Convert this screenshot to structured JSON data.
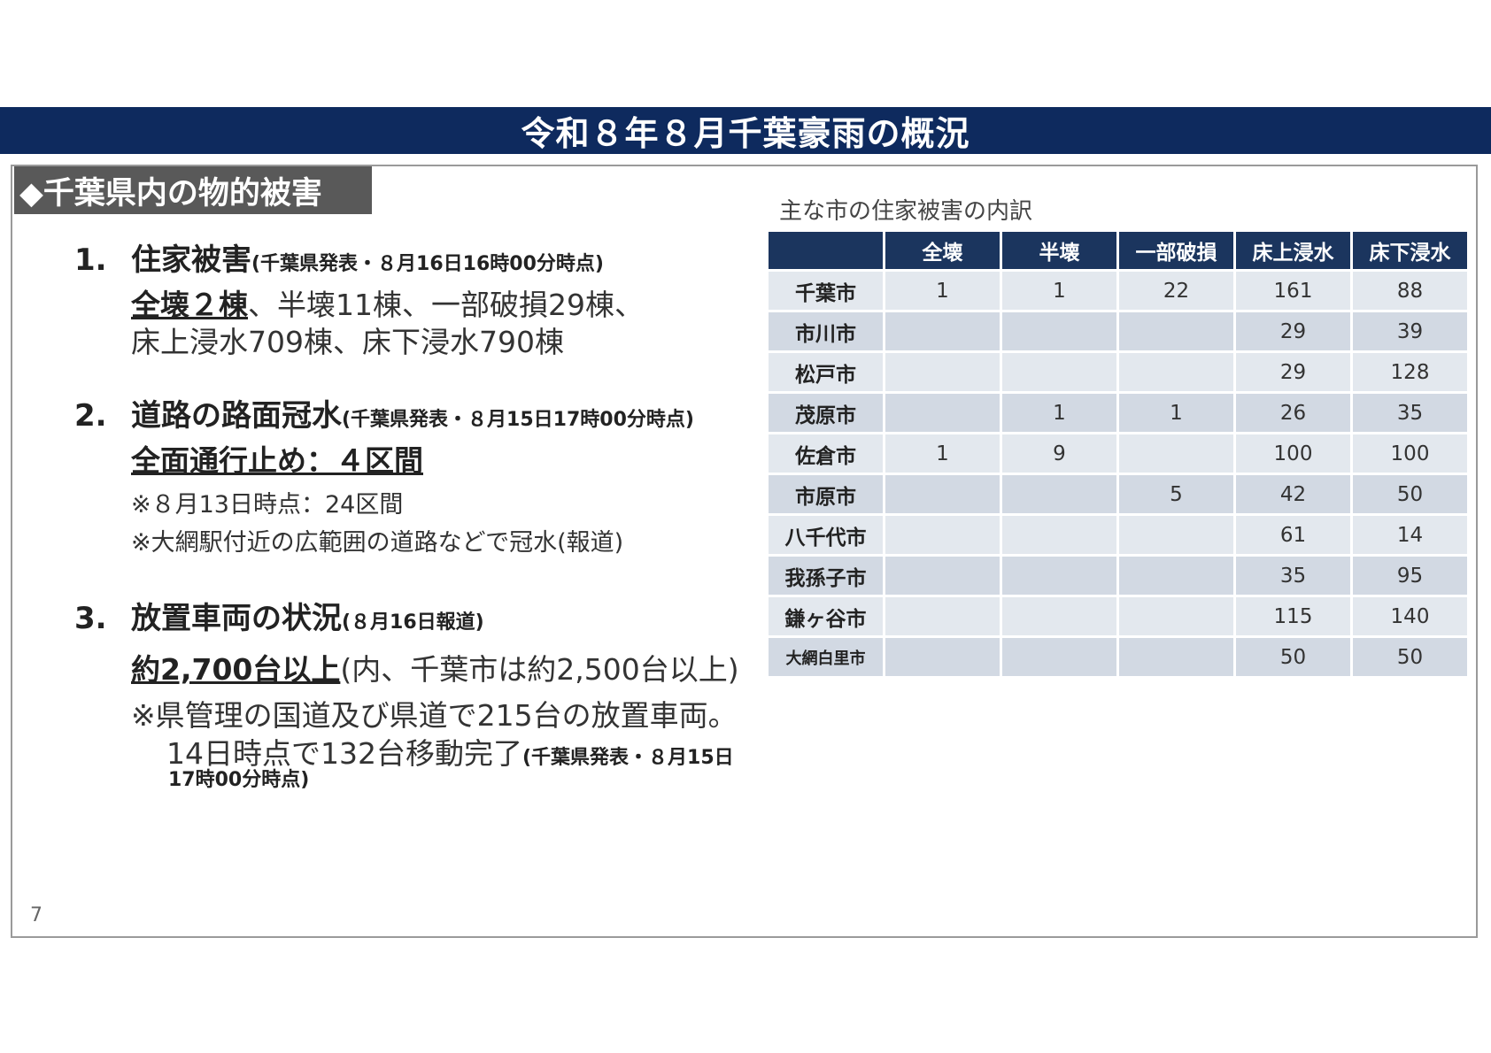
{
  "title": "令和８年８月千葉豪雨の概況",
  "section": "◆千葉県内の物的被害",
  "items": [
    {
      "num": "1.",
      "heading": "住家被害",
      "source": "(千葉県発表・８月16日16時00分時点)",
      "line1_underlined": "全壊２棟",
      "line1_rest": "、半壊11棟、一部破損29棟、",
      "line2": "床上浸水709棟、床下浸水790棟"
    },
    {
      "num": "2.",
      "heading": "道路の路面冠水",
      "source": "(千葉県発表・８月15日17時00分時点)",
      "line1": "全面通行止め：４区間",
      "note1": "※８月13日時点：24区間",
      "note2": "※大網駅付近の広範囲の道路などで冠水(報道)"
    },
    {
      "num": "3.",
      "heading": "放置車両の状況",
      "source": "(８月16日報道)",
      "line1_underlined": "約2,700台以上",
      "line1_rest": "(内、千葉市は約2,500台以上)",
      "line2": "※県管理の国道及び県道で215台の放置車両。",
      "line3": "14日時点で132台移動完了",
      "line3_source": "(千葉県発表・８月15日",
      "line4_source": "17時00分時点)"
    }
  ],
  "table": {
    "caption": "主な市の住家被害の内訳",
    "headers": [
      "",
      "全壊",
      "半壊",
      "一部破損",
      "床上浸水",
      "床下浸水"
    ],
    "rows": [
      [
        "千葉市",
        "1",
        "1",
        "22",
        "161",
        "88"
      ],
      [
        "市川市",
        "",
        "",
        "",
        "29",
        "39"
      ],
      [
        "松戸市",
        "",
        "",
        "",
        "29",
        "128"
      ],
      [
        "茂原市",
        "",
        "1",
        "1",
        "26",
        "35"
      ],
      [
        "佐倉市",
        "1",
        "9",
        "",
        "100",
        "100"
      ],
      [
        "市原市",
        "",
        "",
        "5",
        "42",
        "50"
      ],
      [
        "八千代市",
        "",
        "",
        "",
        "61",
        "14"
      ],
      [
        "我孫子市",
        "",
        "",
        "",
        "35",
        "95"
      ],
      [
        "鎌ヶ谷市",
        "",
        "",
        "",
        "115",
        "140"
      ],
      [
        "大網白里市",
        "",
        "",
        "",
        "50",
        "50"
      ]
    ]
  },
  "page_number": "7",
  "colors": {
    "title_bar": "#0e2a5e",
    "section_tag": "#595959",
    "table_header": "#1b355e",
    "table_cell_light": "#e3e8ee",
    "table_cell_dark": "#d2d9e3"
  }
}
